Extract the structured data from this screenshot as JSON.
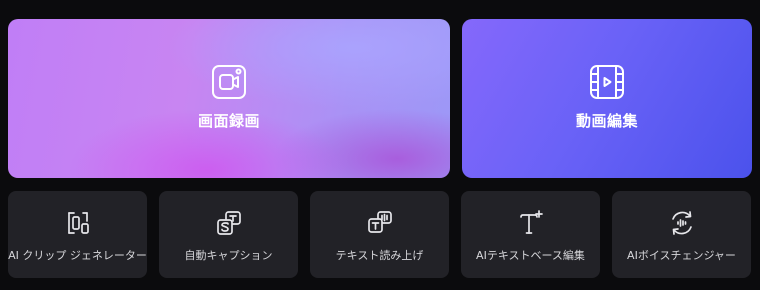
{
  "big_cards": [
    {
      "label": "画面録画",
      "icon": "screen-record-icon"
    },
    {
      "label": "動画編集",
      "icon": "video-edit-icon"
    }
  ],
  "small_cards": [
    {
      "label": "AI クリップ ジェネレーター",
      "icon": "ai-clip-icon"
    },
    {
      "label": "自動キャプション",
      "icon": "auto-caption-icon"
    },
    {
      "label": "テキスト読み上げ",
      "icon": "text-to-speech-icon"
    },
    {
      "label": "AIテキストベース編集",
      "icon": "text-based-edit-icon"
    },
    {
      "label": "AIボイスチェンジャー",
      "icon": "voice-changer-icon"
    }
  ],
  "colors": {
    "background": "#0b0b0d",
    "small_card": "#222227",
    "edit_gradient_start": "#8568fb",
    "edit_gradient_end": "#4b52ec"
  }
}
